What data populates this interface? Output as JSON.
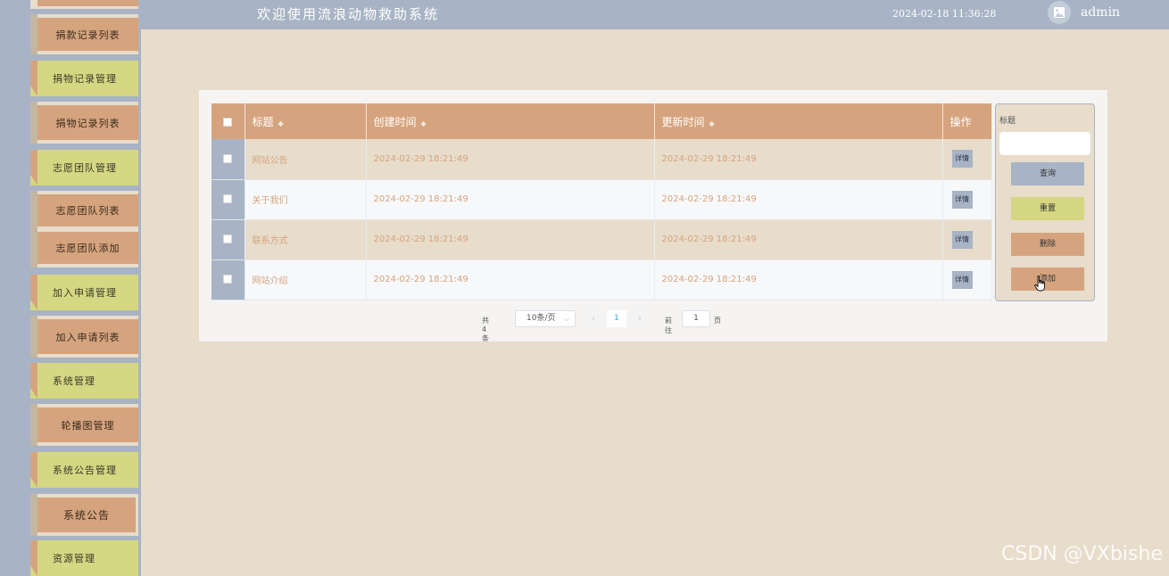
{
  "header": {
    "title": "欢迎使用流浪动物救助系统",
    "datetime": "2024-02-18 11:36:28",
    "username": "admin",
    "avatar_icon": "image-icon"
  },
  "sidebar": {
    "items": [
      {
        "label": "捐款记录列表",
        "kind": "child"
      },
      {
        "label": "捐物记录管理",
        "kind": "parent"
      },
      {
        "label": "捐物记录列表",
        "kind": "child"
      },
      {
        "label": "志愿团队管理",
        "kind": "parent"
      },
      {
        "label": "志愿团队列表",
        "kind": "child"
      },
      {
        "label": "志愿团队添加",
        "kind": "child"
      },
      {
        "label": "加入申请管理",
        "kind": "parent"
      },
      {
        "label": "加入申请列表",
        "kind": "child"
      },
      {
        "label": "系统管理",
        "kind": "parent"
      },
      {
        "label": "轮播图管理",
        "kind": "child"
      },
      {
        "label": "系统公告管理",
        "kind": "parent"
      },
      {
        "label": "系统公告",
        "kind": "child"
      },
      {
        "label": "资源管理",
        "kind": "parent"
      }
    ]
  },
  "table": {
    "headers": {
      "title": "标题",
      "created": "创建时间",
      "updated": "更新时间",
      "actions": "操作"
    },
    "detail_label": "详情",
    "rows": [
      {
        "title": "网站公告",
        "created": "2024-02-29 18:21:49",
        "updated": "2024-02-29 18:21:49"
      },
      {
        "title": "关于我们",
        "created": "2024-02-29 18:21:49",
        "updated": "2024-02-29 18:21:49"
      },
      {
        "title": "联系方式",
        "created": "2024-02-29 18:21:49",
        "updated": "2024-02-29 18:21:49"
      },
      {
        "title": "网站介绍",
        "created": "2024-02-29 18:21:49",
        "updated": "2024-02-29 18:21:49"
      }
    ]
  },
  "search": {
    "label": "标题",
    "input_value": "",
    "query_label": "查询",
    "reset_label": "重置",
    "delete_label": "删除",
    "add_label": "添加"
  },
  "pagination": {
    "total": "共 4 条",
    "page_size": "10条/页",
    "current_page": "1",
    "goto_label": "前往",
    "goto_value": "1",
    "page_unit": "页"
  },
  "watermark": "CSDN @VXbishe",
  "colors": {
    "tan": "#d5a47f",
    "slate": "#a8b4c5",
    "olive": "#d5d782",
    "background": "#e8dccb"
  }
}
